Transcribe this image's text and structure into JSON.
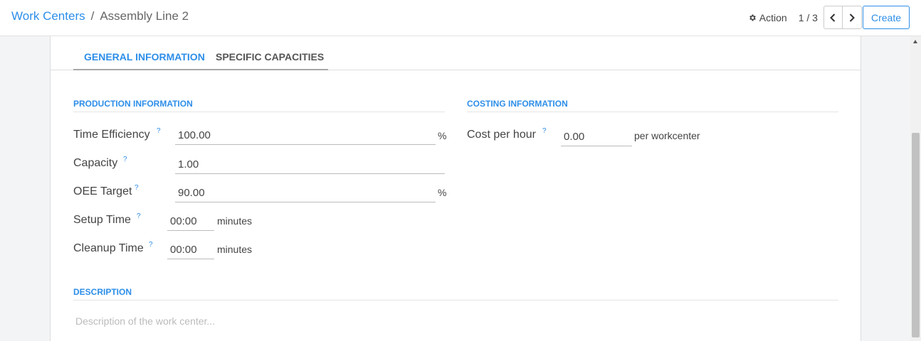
{
  "breadcrumb": {
    "parent": "Work Centers",
    "separator": "/",
    "current": "Assembly Line 2"
  },
  "toolbar": {
    "action_label": "Action",
    "pager": "1 / 3",
    "create_label": "Create"
  },
  "tabs": [
    {
      "label": "GENERAL INFORMATION",
      "active": true
    },
    {
      "label": "SPECIFIC CAPACITIES",
      "active": false
    }
  ],
  "production": {
    "title": "PRODUCTION INFORMATION",
    "time_efficiency": {
      "label": "Time Efficiency",
      "value": "100.00",
      "unit": "%"
    },
    "capacity": {
      "label": "Capacity",
      "value": "1.00"
    },
    "oee_target": {
      "label": "OEE Target",
      "value": "90.00",
      "unit": "%"
    },
    "setup_time": {
      "label": "Setup Time",
      "value": "00:00",
      "unit": "minutes"
    },
    "cleanup_time": {
      "label": "Cleanup Time",
      "value": "00:00",
      "unit": "minutes"
    }
  },
  "costing": {
    "title": "COSTING INFORMATION",
    "cost_per_hour": {
      "label": "Cost per hour",
      "value": "0.00",
      "unit": "per workcenter"
    }
  },
  "description": {
    "title": "DESCRIPTION",
    "placeholder": "Description of the work center..."
  },
  "tooltip_mark": "?",
  "colors": {
    "accent": "#2d8ee8",
    "text": "#444444",
    "background": "#f3f4f6"
  },
  "icons": {
    "action": "gear-icon",
    "prev": "chevron-left-icon",
    "next": "chevron-right-icon"
  }
}
